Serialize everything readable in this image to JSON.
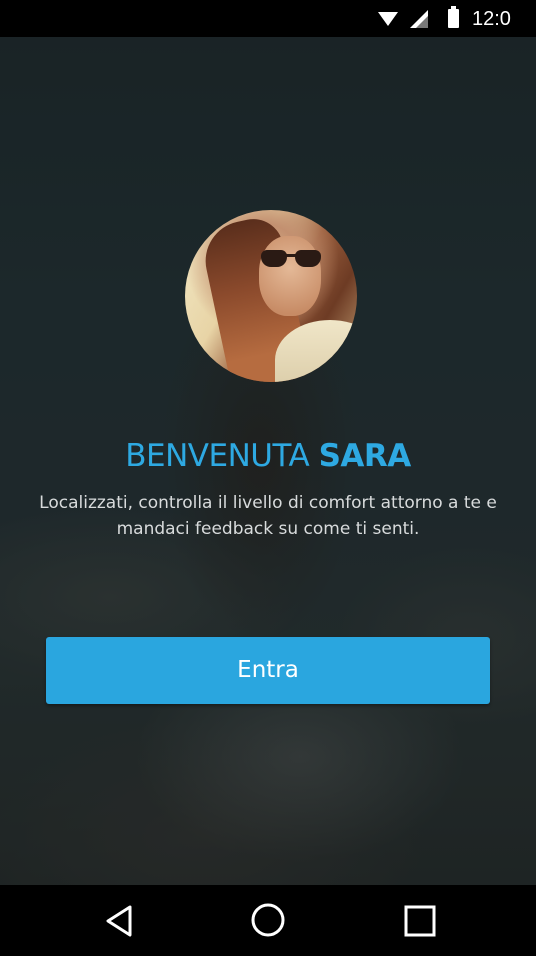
{
  "status_bar": {
    "time": "12:0",
    "icons": [
      "wifi-icon",
      "signal-icon",
      "battery-icon"
    ]
  },
  "welcome": {
    "greeting": "BENVENUTA",
    "name": "SARA",
    "description": "Localizzati, controlla il livello di comfort attorno a te e mandaci feedback su come ti senti."
  },
  "actions": {
    "enter_label": "Entra"
  },
  "navigation": {
    "icons": [
      "back-icon",
      "home-icon",
      "recents-icon"
    ]
  },
  "colors": {
    "accent": "#2ea9e2",
    "button": "#2aa6df",
    "background": "#22302f"
  }
}
